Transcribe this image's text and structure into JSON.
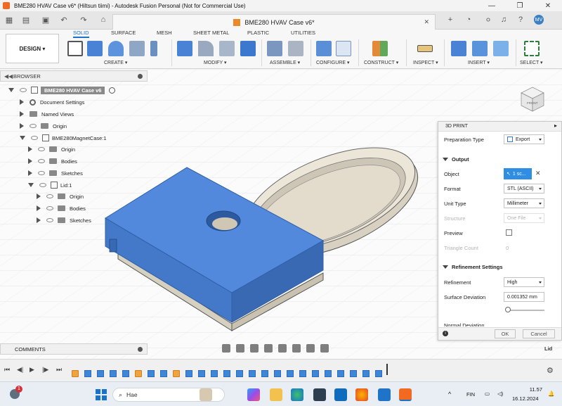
{
  "window": {
    "title": "BME280 HVAV Case v6* (Hiltsun tiimi) - Autodesk Fusion Personal (Not for Commercial Use)",
    "controls": [
      "—",
      "❐",
      "✕"
    ]
  },
  "tabbar": {
    "doc_tab": "BME280 HVAV Case v6*",
    "quick_access": [
      "grid-icon",
      "file-icon",
      "save-icon",
      "undo-icon",
      "redo-icon",
      "home-icon",
      "add-tab-icon",
      "job-status-icon",
      "notifications-icon",
      "help-icon",
      "account-icon"
    ]
  },
  "toolbar": {
    "workspace": "DESIGN ▾",
    "tabs": [
      "SOLID",
      "SURFACE",
      "MESH",
      "SHEET METAL",
      "PLASTIC",
      "UTILITIES"
    ],
    "active_tab": "SOLID",
    "groups": [
      "CREATE ▾",
      "MODIFY ▾",
      "ASSEMBLE ▾",
      "CONFIGURE ▾",
      "CONSTRUCT ▾",
      "INSPECT ▾",
      "INSERT ▾",
      "SELECT ▾"
    ]
  },
  "browser": {
    "title": "BROWSER",
    "root": "BME280 HVAV Case v6",
    "items": [
      {
        "label": "Document Settings",
        "indent": 1
      },
      {
        "label": "Named Views",
        "indent": 1
      },
      {
        "label": "Origin",
        "indent": 1
      },
      {
        "label": "BME280MagnetCase:1",
        "indent": 1
      },
      {
        "label": "Origin",
        "indent": 2
      },
      {
        "label": "Bodies",
        "indent": 2
      },
      {
        "label": "Sketches",
        "indent": 2
      },
      {
        "label": "Lid:1",
        "indent": 2
      },
      {
        "label": "Origin",
        "indent": 3
      },
      {
        "label": "Bodies",
        "indent": 3
      },
      {
        "label": "Sketches",
        "indent": 3
      }
    ]
  },
  "comments": {
    "title": "COMMENTS"
  },
  "print_panel": {
    "title": "3D PRINT",
    "preparation_type_label": "Preparation Type",
    "preparation_type": "Export",
    "output_section": "Output",
    "object_label": "Object",
    "object_value": "1 sc...",
    "format_label": "Format",
    "format_value": "STL (ASCII)",
    "unit_label": "Unit Type",
    "unit_value": "Millimeter",
    "structure_label": "Structure",
    "structure_value": "One File",
    "preview_label": "Preview",
    "triangle_label": "Triangle Count",
    "triangle_value": "0",
    "refinement_section": "Refinement Settings",
    "refinement_label": "Refinement",
    "refinement_value": "High",
    "deviation_label": "Surface Deviation",
    "deviation_value": "0.001352 mm",
    "normal_label": "Normal Deviation",
    "ok": "OK",
    "cancel": "Cancel"
  },
  "viewcube": {
    "face": "FRONT"
  },
  "status": {
    "selected_label": "Lid"
  },
  "taskbar": {
    "search_placeholder": "Hae",
    "notification_count": "1",
    "language": "FIN",
    "time": "11.57",
    "date": "16.12.2024"
  },
  "colors": {
    "accent": "#1a73c9",
    "lid_blue": "#4a82d6",
    "case_beige": "#e8e2d4",
    "fusion_orange": "#f26a21"
  }
}
